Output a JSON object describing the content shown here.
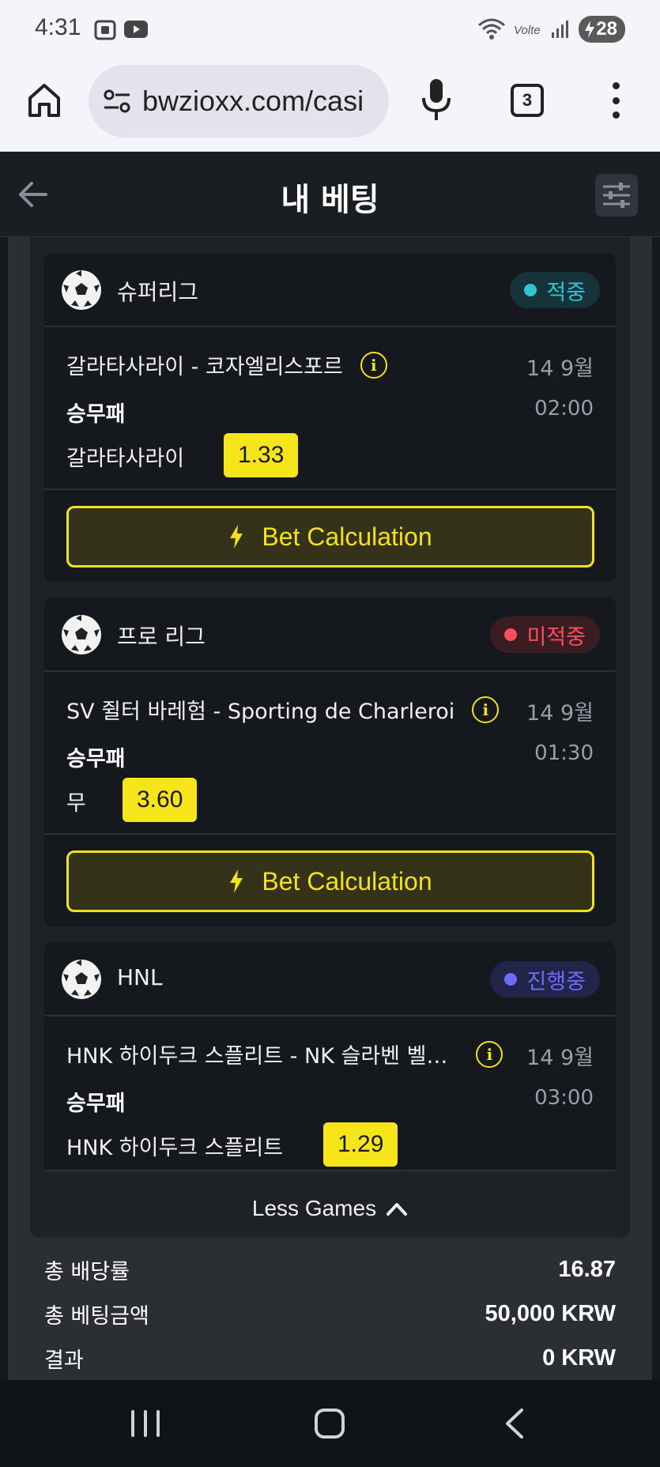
{
  "status_bar": {
    "time": "4:31",
    "battery": "28"
  },
  "browser": {
    "url": "bwzioxx.com/casi",
    "tab_count": "3"
  },
  "header": {
    "title": "내 베팅"
  },
  "bets": [
    {
      "league": "슈퍼리그",
      "status": "적중",
      "match": "갈라타사라이 - 코자엘리스포르",
      "date": "14 9월",
      "market": "승무패",
      "time": "02:00",
      "pick": "갈라타사라이",
      "odds": "1.33",
      "button": "Bet Calculation"
    },
    {
      "league": "프로 리그",
      "status": "미적중",
      "match": "SV 쥘터 바레험 - Sporting de Charleroi",
      "date": "14 9월",
      "market": "승무패",
      "time": "01:30",
      "pick": "무",
      "odds": "3.60",
      "button": "Bet Calculation"
    },
    {
      "league": "HNL",
      "status": "진행중",
      "match": "HNK 하이두크 스플리트 - NK 슬라벤 벨…",
      "date": "14 9월",
      "market": "승무패",
      "time": "03:00",
      "pick": "HNK 하이두크 스플리트",
      "odds": "1.29"
    }
  ],
  "less_games": "Less Games",
  "summary": {
    "total_odds_label": "총 배당률",
    "total_odds": "16.87",
    "total_stake_label": "총 베팅금액",
    "total_stake": "50,000 KRW",
    "result_label": "결과",
    "result": "0 KRW"
  },
  "colors": {
    "accent": "#f2e11c",
    "win": "#2ec4d0",
    "lose": "#ff4d5e",
    "live": "#6c6cf5"
  }
}
